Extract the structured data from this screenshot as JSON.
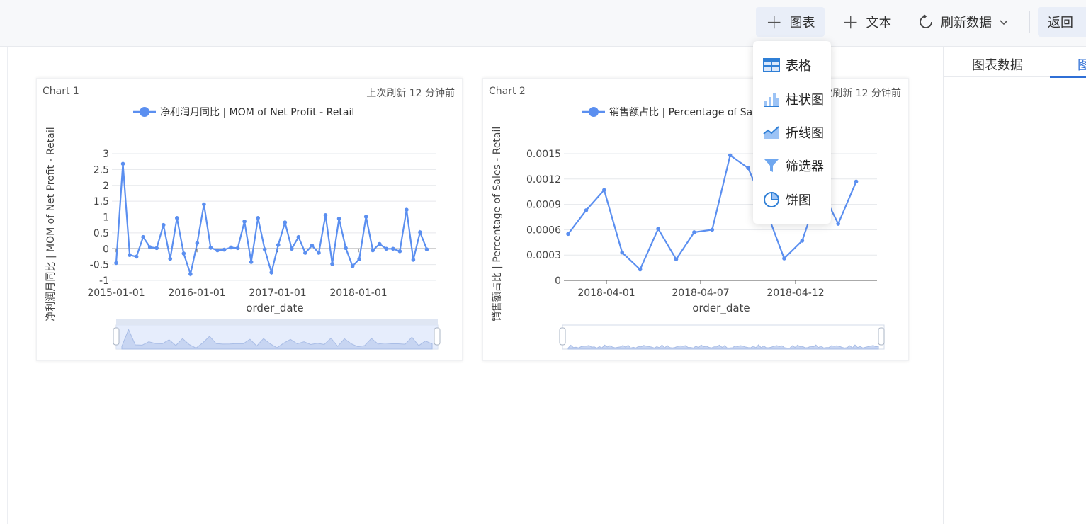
{
  "toolbar": {
    "chart_label": "图表",
    "text_label": "文本",
    "refresh_label": "刷新数据",
    "back_label": "返回"
  },
  "dropdown": {
    "items": [
      {
        "label": "表格",
        "icon": "table-icon"
      },
      {
        "label": "柱状图",
        "icon": "bar-chart-icon"
      },
      {
        "label": "折线图",
        "icon": "line-chart-icon"
      },
      {
        "label": "筛选器",
        "icon": "filter-icon"
      },
      {
        "label": "饼图",
        "icon": "pie-chart-icon"
      }
    ]
  },
  "right_panel": {
    "tabs": [
      "图表数据",
      "图"
    ]
  },
  "cards": [
    {
      "title": "Chart 1",
      "refresh": "上次刷新 12 分钟前"
    },
    {
      "title": "Chart 2",
      "refresh": "上次刷新 12 分钟前"
    }
  ],
  "colors": {
    "series": "#5b8ff0",
    "accent": "#2f6fd6"
  },
  "chart_data": [
    {
      "type": "line",
      "legend": "净利润月同比 | MOM of Net Profit - Retail",
      "xlabel": "order_date",
      "ylabel": "净利润月同比 | MOM of Net Profit - Retail",
      "ylim": [
        -1,
        3
      ],
      "yticks": [
        "3",
        "2.5",
        "2",
        "1.5",
        "1",
        "0.5",
        "0",
        "-0.5",
        "-1"
      ],
      "xticks": [
        "2015-01-01",
        "2016-01-01",
        "2017-01-01",
        "2018-01-01"
      ],
      "x": [
        "2015-01",
        "2015-02",
        "2015-03",
        "2015-04",
        "2015-05",
        "2015-06",
        "2015-07",
        "2015-08",
        "2015-09",
        "2015-10",
        "2015-11",
        "2015-12",
        "2016-01",
        "2016-02",
        "2016-03",
        "2016-04",
        "2016-05",
        "2016-06",
        "2016-07",
        "2016-08",
        "2016-09",
        "2016-10",
        "2016-11",
        "2016-12",
        "2017-01",
        "2017-02",
        "2017-03",
        "2017-04",
        "2017-05",
        "2017-06",
        "2017-07",
        "2017-08",
        "2017-09",
        "2017-10",
        "2017-11",
        "2017-12",
        "2018-01",
        "2018-02",
        "2018-03",
        "2018-04",
        "2018-05",
        "2018-06",
        "2018-07",
        "2018-08",
        "2018-09",
        "2018-10",
        "2018-11",
        "2018-12"
      ],
      "values": [
        -0.45,
        2.68,
        -0.2,
        -0.25,
        0.37,
        0.05,
        0.02,
        0.75,
        -0.32,
        0.97,
        -0.15,
        -0.8,
        0.18,
        1.4,
        0.03,
        -0.05,
        -0.03,
        0.04,
        0.02,
        0.86,
        -0.42,
        0.97,
        -0.02,
        -0.75,
        0.12,
        0.83,
        0.0,
        0.37,
        -0.13,
        0.1,
        -0.13,
        1.06,
        -0.48,
        0.95,
        0.02,
        -0.55,
        -0.33,
        1.01,
        -0.05,
        0.15,
        0.0,
        0.0,
        -0.08,
        1.23,
        -0.35,
        0.52,
        -0.02
      ]
    },
    {
      "type": "line",
      "legend": "销售额占比 | Percentage of Sales - Retail",
      "xlabel": "order_date",
      "ylabel": "销售额占比 | Percentage of Sales - Retail",
      "ylim": [
        0,
        0.0015
      ],
      "yticks": [
        "0.0015",
        "0.0012",
        "0.0009",
        "0.0006",
        "0.0003",
        "0"
      ],
      "xticks": [
        "2018-04-01",
        "2018-04-07",
        "2018-04-12"
      ],
      "x": [
        "2018-03-30",
        "2018-03-31",
        "2018-04-01",
        "2018-04-02",
        "2018-04-03",
        "2018-04-04",
        "2018-04-05",
        "2018-04-06",
        "2018-04-07",
        "2018-04-08",
        "2018-04-09",
        "2018-04-10",
        "2018-04-11",
        "2018-04-12",
        "2018-04-13",
        "2018-04-14",
        "2018-04-15",
        "2018-04-16"
      ],
      "values": [
        0.00055,
        0.00083,
        0.00107,
        0.00033,
        0.00013,
        0.00061,
        0.00025,
        0.00057,
        0.0006,
        0.00148,
        0.00133,
        0.00083,
        0.00026,
        0.00047,
        0.0011,
        0.00067,
        0.00117,
        null
      ]
    }
  ]
}
